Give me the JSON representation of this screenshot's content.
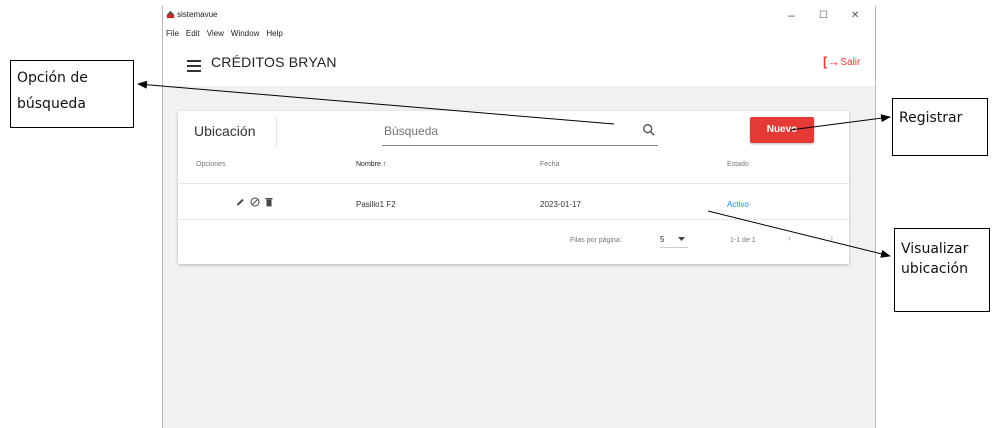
{
  "window": {
    "app_title": "sistemavue",
    "controls": {
      "minimize": "–",
      "maximize": "☐",
      "close": "✕"
    }
  },
  "menu": [
    "File",
    "Edit",
    "View",
    "Window",
    "Help"
  ],
  "appbar": {
    "title": "CRÉDITOS BRYAN",
    "logout": "Salir"
  },
  "panel": {
    "title": "Ubicación",
    "search_placeholder": "Búsqueda",
    "new_button": "Nuevo",
    "columns": {
      "options": "Opciones",
      "name": "Nombre ↑",
      "date": "Fecha",
      "status": "Estado"
    },
    "rows": [
      {
        "name": "Pasillo1 F2",
        "date": "2023-01-17",
        "status": "Activo"
      }
    ],
    "footer": {
      "rows_per_page_label": "Filas por página:",
      "rows_per_page_value": "5",
      "range": "1-1 de 1",
      "prev": "‹",
      "next": "›"
    }
  },
  "annotations": {
    "search_option": [
      "Opción de",
      "búsqueda"
    ],
    "register": "Registrar",
    "view_location": [
      "Visualizar",
      "ubicación"
    ]
  },
  "colors": {
    "accent_red": "#e53935",
    "status_blue": "#1e88e5",
    "content_bg": "#f3f1ef"
  }
}
